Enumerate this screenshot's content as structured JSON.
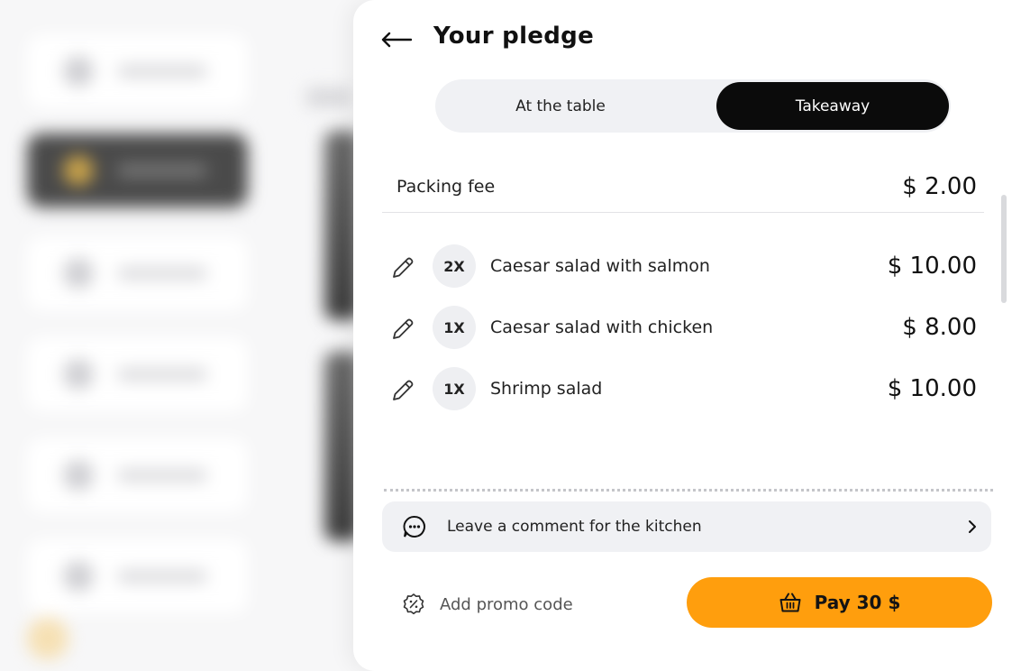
{
  "background_app": {
    "accent_color": "#f6e0b3"
  },
  "panel": {
    "title": "Your pledge",
    "back_icon": "arrow-left-icon"
  },
  "order_type": {
    "options": [
      {
        "label": "At the table",
        "selected": false
      },
      {
        "label": "Takeaway",
        "selected": true
      }
    ]
  },
  "packing_fee": {
    "label": "Packing fee",
    "price": "$ 2.00"
  },
  "items": [
    {
      "qty": "2X",
      "name": "Caesar salad with salmon",
      "price": "$ 10.00"
    },
    {
      "qty": "1X",
      "name": "Caesar salad with chicken",
      "price": "$ 8.00"
    },
    {
      "qty": "1X",
      "name": "Shrimp salad",
      "price": "$ 10.00"
    }
  ],
  "comment": {
    "label": "Leave a comment for the kitchen",
    "icon": "chat-bubble-icon",
    "chevron": "chevron-right-icon"
  },
  "promo": {
    "label": "Add promo code",
    "icon": "discount-badge-icon"
  },
  "pay": {
    "label": "Pay 30 $",
    "icon": "basket-icon",
    "color": "#ff9e0d"
  }
}
